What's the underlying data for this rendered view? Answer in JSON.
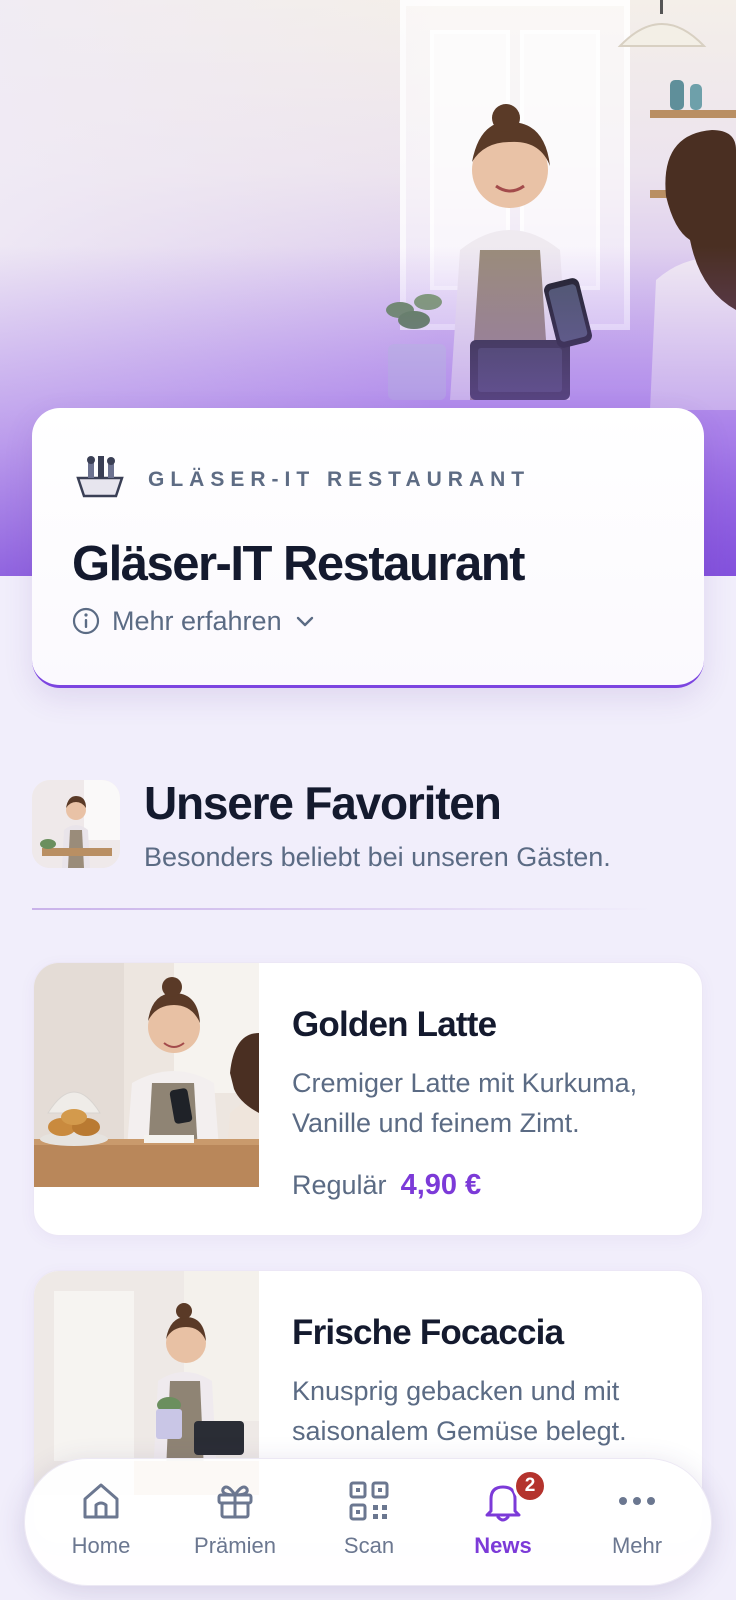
{
  "hero": {
    "image_alt": "Café-Mitarbeiterin am Kassenterminal"
  },
  "brand": {
    "eyebrow": "GLÄSER-IT RESTAURANT",
    "title": "Gläser-IT Restaurant",
    "more_label": "Mehr erfahren",
    "accent_color": "#7c3ad8"
  },
  "favorites": {
    "title": "Unsere Favoriten",
    "subtitle": "Besonders beliebt bei unseren Gästen."
  },
  "products": [
    {
      "name": "Golden Latte",
      "description": "Cremiger Latte mit Kurkuma, Vanille und feinem Zimt.",
      "price_label": "Regulär",
      "price": "4,90 €"
    },
    {
      "name": "Frische Focaccia",
      "description": "Knusprig gebacken und mit saisonalem Gemüse belegt.",
      "price_label": "",
      "price": ""
    }
  ],
  "nav": {
    "items": [
      {
        "label": "Home",
        "icon": "home-icon"
      },
      {
        "label": "Prämien",
        "icon": "gift-icon"
      },
      {
        "label": "Scan",
        "icon": "qr-code-icon"
      },
      {
        "label": "News",
        "icon": "bell-icon",
        "badge": "2",
        "active": true
      },
      {
        "label": "Mehr",
        "icon": "more-dots-icon"
      }
    ]
  }
}
